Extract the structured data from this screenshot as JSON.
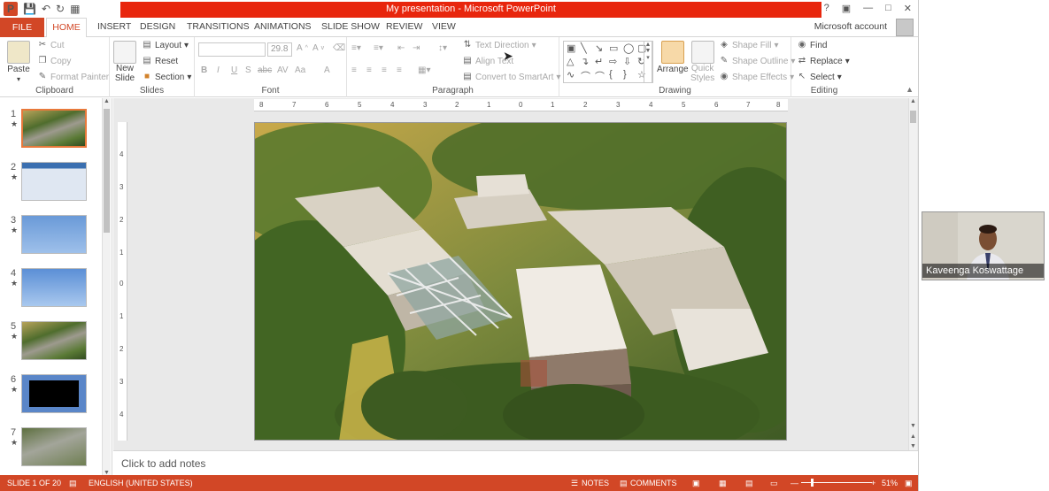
{
  "window": {
    "title": "My presentation - Microsoft PowerPoint",
    "help_icon": "question-icon",
    "min_icon": "minimize-icon"
  },
  "tabs": {
    "file": "FILE",
    "items": [
      "HOME",
      "INSERT",
      "DESIGN",
      "TRANSITIONS",
      "ANIMATIONS",
      "SLIDE SHOW",
      "REVIEW",
      "VIEW"
    ],
    "account": "Microsoft account"
  },
  "ribbon": {
    "clipboard": {
      "label": "Clipboard",
      "paste": "Paste",
      "cut": "Cut",
      "copy": "Copy",
      "format_painter": "Format Painter"
    },
    "slides": {
      "label": "Slides",
      "new_slide": "New",
      "new_slide_2": "Slide",
      "layout": "Layout",
      "reset": "Reset",
      "section": "Section"
    },
    "font": {
      "label": "Font",
      "font_size": "29.8",
      "bold": "B",
      "italic": "I",
      "underline": "U",
      "shadow": "S",
      "strike": "abc",
      "spacing": "AV",
      "case": "Aa",
      "color": "A"
    },
    "paragraph": {
      "label": "Paragraph",
      "text_direction": "Text Direction",
      "align_text": "Align Text",
      "convert_smartart": "Convert to SmartArt"
    },
    "drawing": {
      "label": "Drawing",
      "arrange": "Arrange",
      "quick_styles": "Quick",
      "quick_styles_2": "Styles",
      "shape_fill": "Shape Fill",
      "shape_outline": "Shape Outline",
      "shape_effects": "Shape Effects"
    },
    "editing": {
      "label": "Editing",
      "find": "Find",
      "replace": "Replace",
      "select": "Select"
    }
  },
  "slides": [
    {
      "num": "1",
      "star": "★",
      "theme": "photo"
    },
    {
      "num": "2",
      "star": "★",
      "theme": "screenshot"
    },
    {
      "num": "3",
      "star": "★",
      "theme": "blue-title"
    },
    {
      "num": "4",
      "star": "★",
      "theme": "blue-heading"
    },
    {
      "num": "5",
      "star": "★",
      "theme": "photo"
    },
    {
      "num": "6",
      "star": "★",
      "theme": "dark"
    },
    {
      "num": "7",
      "star": "★",
      "theme": "photo-2"
    }
  ],
  "ruler": {
    "top": [
      "8",
      "7",
      "6",
      "5",
      "4",
      "3",
      "2",
      "1",
      "0",
      "1",
      "2",
      "3",
      "4",
      "5",
      "6",
      "7",
      "8"
    ],
    "left": [
      "4",
      "3",
      "2",
      "1",
      "0",
      "1",
      "2",
      "3",
      "4"
    ]
  },
  "notes": {
    "placeholder": "Click to add notes"
  },
  "status": {
    "slide": "SLIDE 1 OF 20",
    "language": "ENGLISH (UNITED STATES)",
    "notes": "NOTES",
    "comments": "COMMENTS",
    "zoom": "51%"
  },
  "webcam": {
    "name": "Kaveenga Koswattage"
  }
}
